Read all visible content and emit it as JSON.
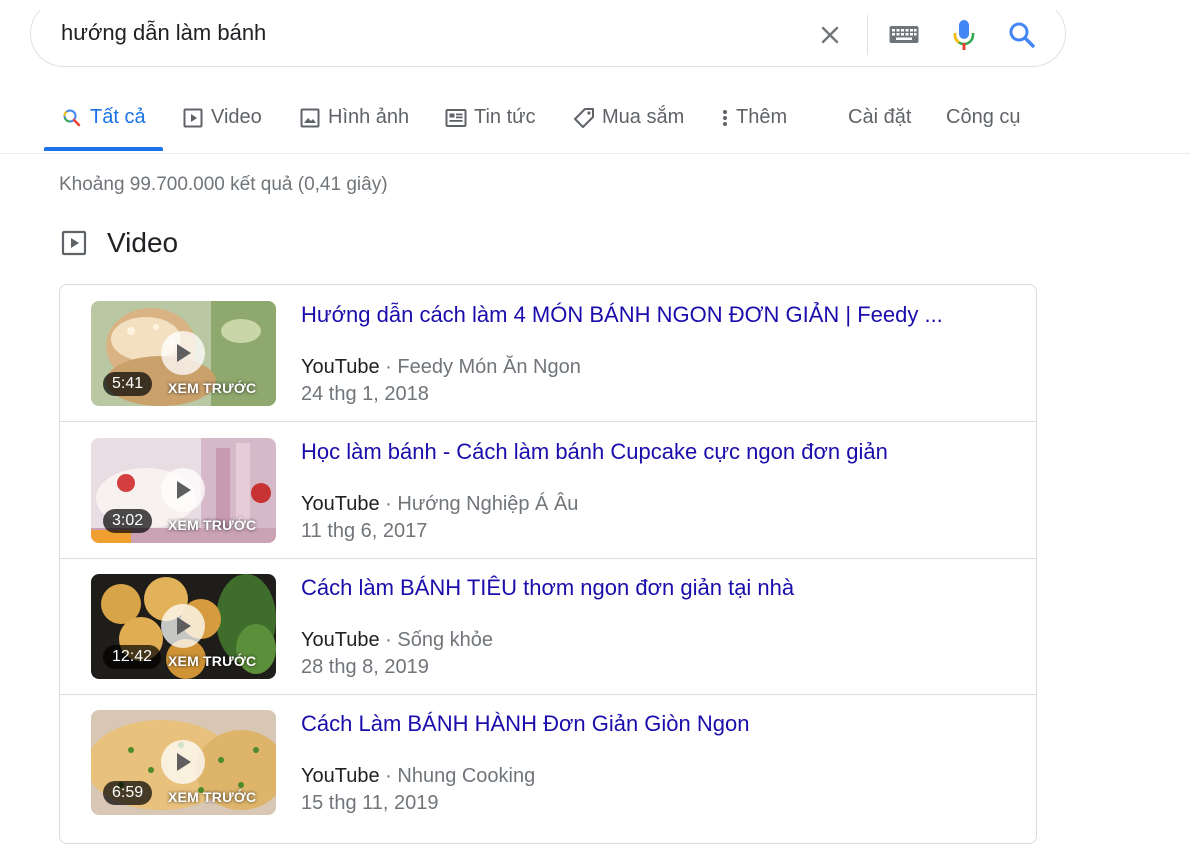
{
  "search": {
    "query": "hướng dẫn làm bánh"
  },
  "tabs": [
    {
      "label": "Tất cả",
      "icon": "search-icon",
      "active": true
    },
    {
      "label": "Video",
      "icon": "play-box-icon"
    },
    {
      "label": "Hình ảnh",
      "icon": "image-icon"
    },
    {
      "label": "Tin tức",
      "icon": "news-icon"
    },
    {
      "label": "Mua sắm",
      "icon": "tag-icon"
    },
    {
      "label": "Thêm",
      "icon": "more-vert-icon"
    },
    {
      "label": "Cài đặt"
    },
    {
      "label": "Công cụ"
    }
  ],
  "result_stats": "Khoảng 99.700.000 kết quả (0,41 giây)",
  "video_section": {
    "title": "Video",
    "preview_label": "XEM TRƯỚC",
    "items": [
      {
        "title": "Hướng dẫn cách làm 4 MÓN BÁNH NGON ĐƠN GIẢN | Feedy ...",
        "source": "YouTube",
        "channel": "Feedy Món Ăn Ngon",
        "date": "24 thg 1, 2018",
        "duration": "5:41"
      },
      {
        "title": "Học làm bánh - Cách làm bánh Cupcake cực ngon đơn giản",
        "source": "YouTube",
        "channel": "Hướng Nghiệp Á Âu",
        "date": "11 thg 6, 2017",
        "duration": "3:02"
      },
      {
        "title": "Cách làm BÁNH TIÊU thơm ngon đơn giản tại nhà",
        "source": "YouTube",
        "channel": "Sống khỏe",
        "date": "28 thg 8, 2019",
        "duration": "12:42"
      },
      {
        "title": "Cách Làm BÁNH HÀNH Đơn Giản Giòn Ngon",
        "source": "YouTube",
        "channel": "Nhung Cooking",
        "date": "15 thg 11, 2019",
        "duration": "6:59"
      }
    ]
  },
  "colors": {
    "accent": "#1a73e8",
    "link": "#1a0dab",
    "muted": "#70757a"
  }
}
